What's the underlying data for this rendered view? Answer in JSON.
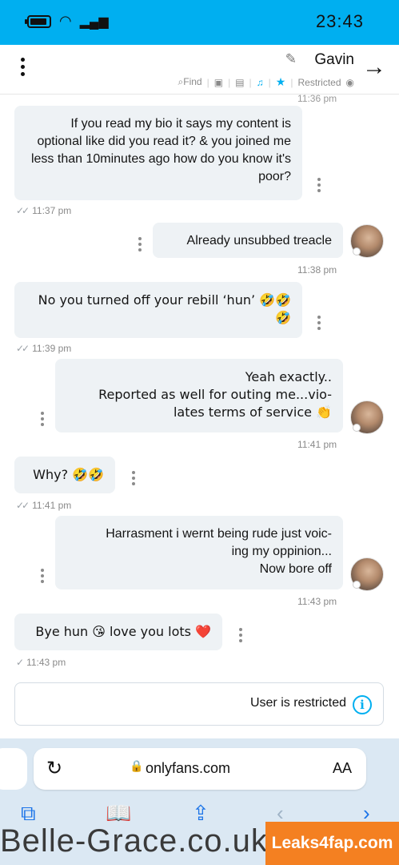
{
  "status_bar": {
    "time": "23:43"
  },
  "header": {
    "contact_name": "Gavin",
    "tools": {
      "find": "Find",
      "restricted": "Restricted"
    }
  },
  "conversation": {
    "previous_time": "11:36 pm",
    "messages": [
      {
        "sender": "me",
        "text": "If you read my bio it says my content is optional like did you read it? & you joined me less than 10minutes ago how do you know it's poor?",
        "time": "11:37 pm"
      },
      {
        "sender": "them",
        "text": "Already unsubbed treacle",
        "time": "11:38 pm"
      },
      {
        "sender": "me",
        "text": "No you turned off your rebill ‘hun’ 🤣🤣\n🤣",
        "time": "11:39 pm"
      },
      {
        "sender": "them",
        "text": "Yeah exactly..\nReported as well for outing me...vio-\nlates terms of service 👏",
        "time": "11:41 pm"
      },
      {
        "sender": "me",
        "text": "Why? 🤣🤣",
        "time": "11:41 pm"
      },
      {
        "sender": "them",
        "text": "Harrasment i wernt being rude just voic-\ning my oppinion...\nNow bore off",
        "time": "11:43 pm"
      },
      {
        "sender": "me",
        "text": "Bye hun 😘 love you lots ❤️",
        "time": "11:43 pm"
      }
    ]
  },
  "notice": {
    "text": "User is restricted"
  },
  "browser": {
    "url": "onlyfans.com",
    "text_size_label": "AA",
    "icons": [
      "reload-icon",
      "lock-icon",
      "back-icon",
      "forward-icon",
      "share-icon",
      "bookmarks-icon",
      "tabs-icon"
    ]
  },
  "watermark": {
    "text": "Belle-Grace.co.uk",
    "badge": "Leaks4fap.com"
  },
  "colors": {
    "accent": "#00aff0",
    "bubble": "#eef2f5"
  }
}
